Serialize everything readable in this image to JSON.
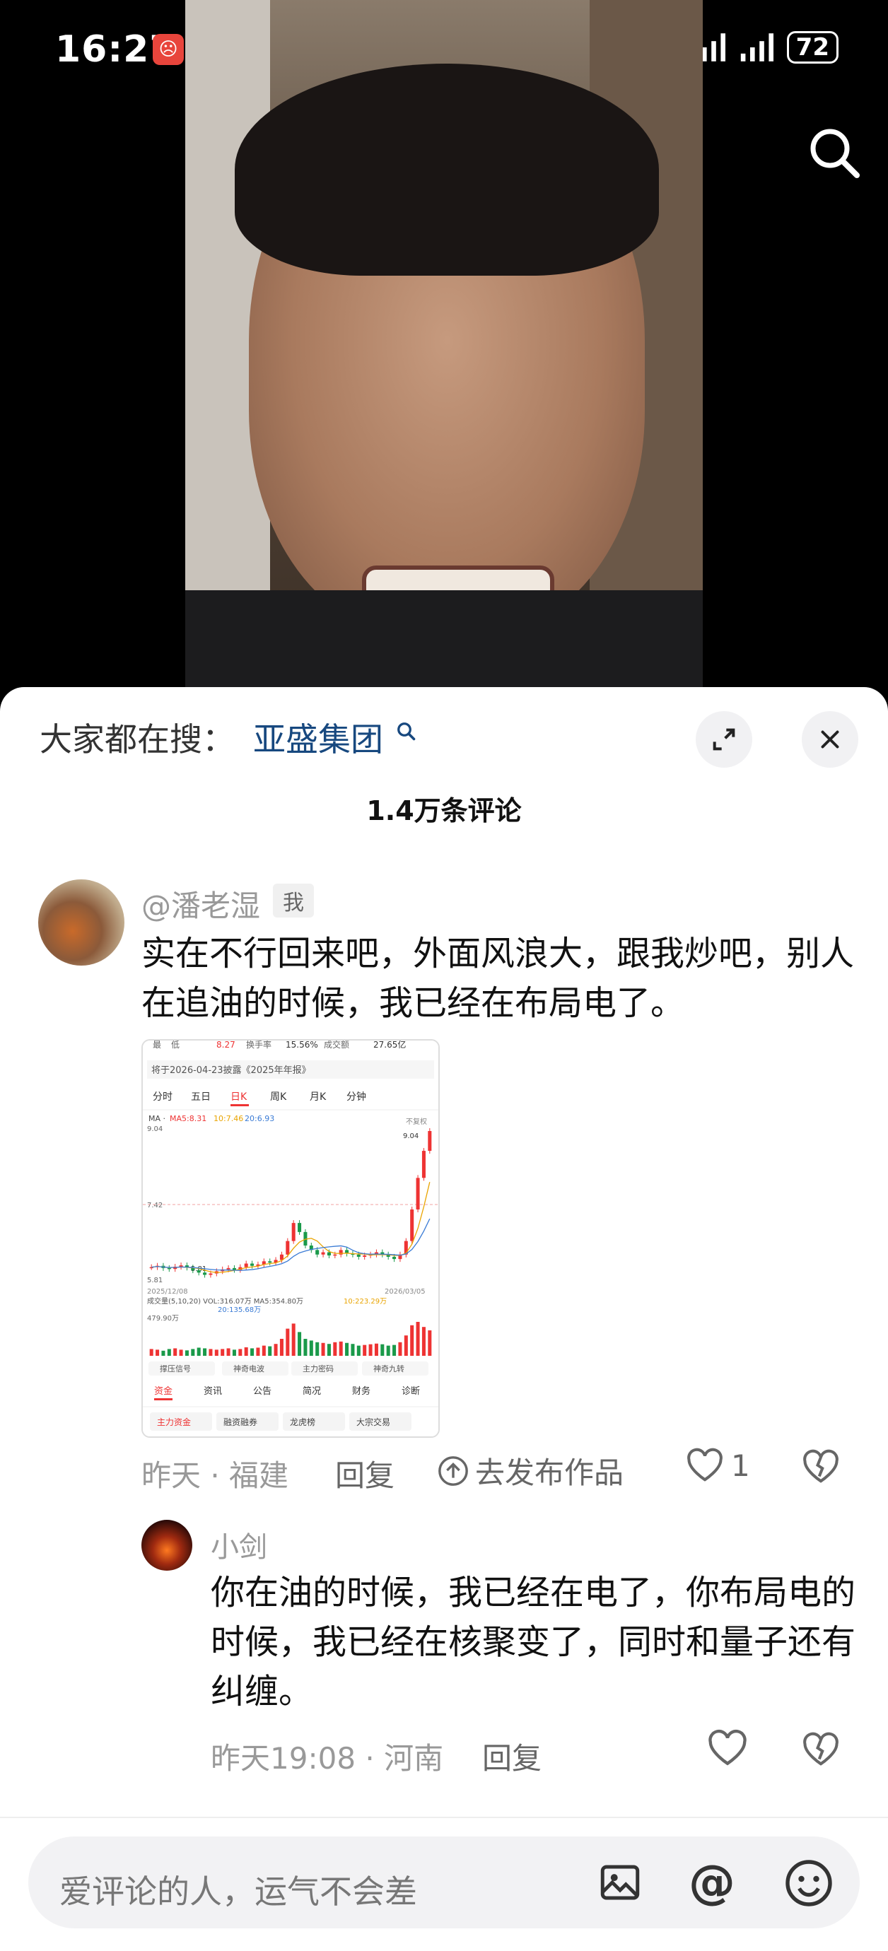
{
  "status_bar": {
    "time": "16:27",
    "battery": "72",
    "app_icons": [
      "alert-app-icon",
      "avatar-app-icon",
      "c-app-icon",
      "tiktok-icon"
    ],
    "system_icons": [
      "nfc-icon",
      "alarm-icon",
      "bluetooth-icon",
      "vibrate-icon",
      "wifi-icon",
      "signal-icon",
      "signal-icon-2",
      "battery-icon"
    ]
  },
  "video": {
    "search_icon": "search-icon"
  },
  "comments_header": {
    "hot_label": "大家都在搜：",
    "hot_link": "亚盛集团",
    "count": "1.4万条评论",
    "expand_icon": "expand-icon",
    "close_icon": "close-icon"
  },
  "comment1": {
    "username": "@潘老湿",
    "tag": "我",
    "text": "实在不行回来吧，外面风浪大，跟我炒吧，别人在追油的时候，我已经在布局电了。",
    "meta": "昨天 · 福建",
    "reply": "回复",
    "publish": "去发布作品",
    "likes": "1"
  },
  "chart_image": {
    "top_row": [
      "最",
      "低",
      "8.27",
      "换手率",
      "15.56%",
      "成交额",
      "27.65亿"
    ],
    "notice": "将于2026-04-23披露《2025年年报》",
    "tabs": [
      "分时",
      "五日",
      "日K",
      "周K",
      "月K",
      "分钟"
    ],
    "ma_line": "MA5:8.31",
    "ma10": "10:7.46",
    "ma20": "20:6.93",
    "y_high": "9.04",
    "y_mid": "7.42",
    "y_low": "5.81",
    "peak": "9.04",
    "low_mark": "5.81",
    "no_adjust": "不复权",
    "date_start": "2025/12/08",
    "date_end": "2026/03/05",
    "vol_line": "成交量(5,10,20) VOL:316.07万 MA5:354.80万",
    "vol_ma10": "10:223.29万",
    "vol_ma20": "20:135.68万",
    "vol_max": "479.90万",
    "signals": [
      "撑压信号",
      "神奇电波",
      "主力密码",
      "神奇九转"
    ],
    "bottom_tabs": [
      "资金",
      "资讯",
      "公告",
      "简况",
      "财务",
      "诊断"
    ],
    "bottom_buttons": [
      "主力资金",
      "融资融券",
      "龙虎榜",
      "大宗交易"
    ],
    "chart_data": {
      "type": "candlestick",
      "ylim": [
        5.81,
        9.04
      ],
      "closes": [
        6.02,
        6.05,
        6.0,
        5.98,
        6.03,
        6.06,
        6.01,
        5.95,
        5.9,
        5.85,
        5.88,
        5.93,
        5.97,
        6.0,
        5.96,
        6.02,
        6.1,
        6.05,
        6.08,
        6.15,
        6.12,
        6.18,
        6.3,
        6.6,
        7.0,
        6.8,
        6.5,
        6.4,
        6.3,
        6.35,
        6.28,
        6.3,
        6.4,
        6.32,
        6.3,
        6.25,
        6.28,
        6.3,
        6.35,
        6.3,
        6.25,
        6.2,
        6.3,
        6.6,
        7.3,
        8.0,
        8.6,
        9.04
      ],
      "volumes": [
        0.2,
        0.18,
        0.15,
        0.2,
        0.22,
        0.18,
        0.16,
        0.2,
        0.24,
        0.22,
        0.2,
        0.18,
        0.2,
        0.22,
        0.18,
        0.2,
        0.25,
        0.22,
        0.24,
        0.3,
        0.28,
        0.35,
        0.5,
        0.8,
        0.95,
        0.7,
        0.5,
        0.45,
        0.4,
        0.38,
        0.35,
        0.4,
        0.42,
        0.38,
        0.35,
        0.3,
        0.32,
        0.34,
        0.36,
        0.34,
        0.3,
        0.32,
        0.4,
        0.6,
        0.9,
        1.0,
        0.85,
        0.75
      ]
    }
  },
  "reply_comment": {
    "username": "小剑",
    "text": "你在油的时候，我已经在电了，你布局电的时候，我已经在核聚变了，同时和量子还有纠缠。",
    "meta": "昨天19:08 · 河南",
    "reply": "回复"
  },
  "input_bar": {
    "placeholder": "爱评论的人，运气不会差",
    "at_symbol": "@"
  }
}
